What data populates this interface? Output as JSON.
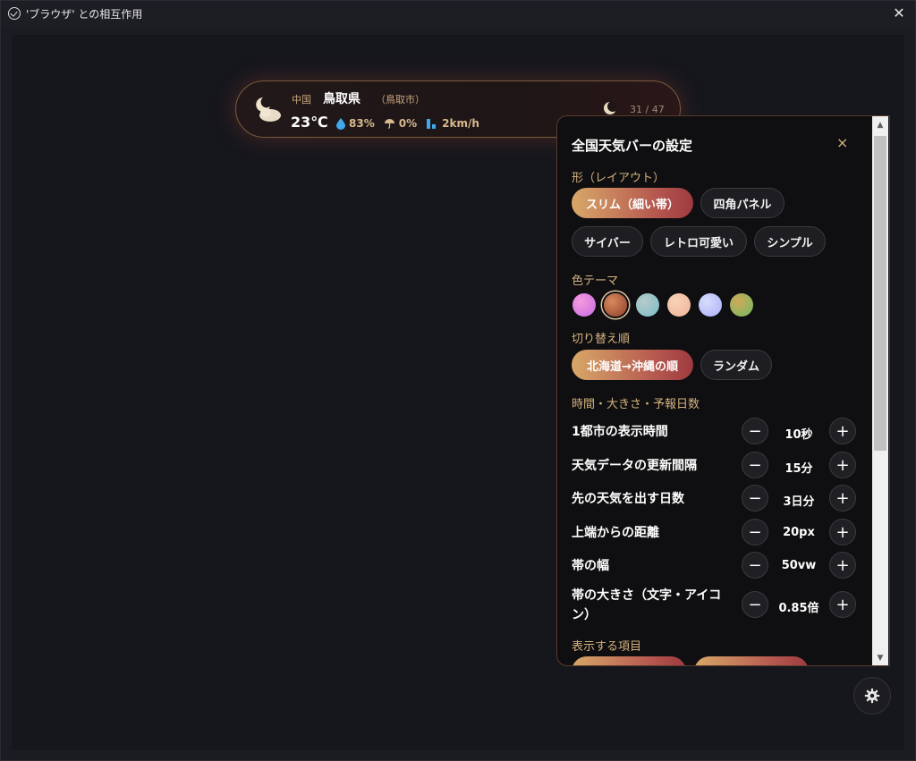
{
  "window": {
    "title": "'ブラウザ' との相互作用"
  },
  "weather_bar": {
    "region": "中国",
    "prefecture": "鳥取県",
    "city": "（鳥取市）",
    "temperature": "23℃",
    "humidity": "83%",
    "precipitation": "0%",
    "wind": "2km/h",
    "counter": "31 / 47"
  },
  "settings": {
    "title": "全国天気バーの設定",
    "layout_label": "形（レイアウト）",
    "layouts": [
      "スリム（細い帯）",
      "四角パネル",
      "サイバー",
      "レトロ可愛い",
      "シンプル"
    ],
    "layout_selected": "スリム（細い帯）",
    "theme_label": "色テーマ",
    "theme_colors": [
      "#e77fe0",
      "#b05a3e",
      "#8fc4c9",
      "#f3c1a4",
      "#b7bdfa",
      "#a6b454"
    ],
    "order_label": "切り替え順",
    "orders": [
      "北海道→沖縄の順",
      "ランダム"
    ],
    "order_selected": "北海道→沖縄の順",
    "timing_label": "時間・大きさ・予報日数",
    "rows": [
      {
        "label": "1都市の表示時間",
        "value": "10秒"
      },
      {
        "label": "天気データの更新間隔",
        "value": "15分"
      },
      {
        "label": "先の天気を出す日数",
        "value": "3日分"
      },
      {
        "label": "上端からの距離",
        "value": "20px"
      },
      {
        "label": "帯の幅",
        "value": "50vw"
      },
      {
        "label": "帯の大きさ（文字・アイコン）",
        "value": "0.85倍"
      }
    ],
    "items_label": "表示する項目",
    "close_label": "×",
    "minus": "−",
    "plus": "+"
  },
  "icons": {
    "window_close": "close-icon",
    "settings": "gear-icon"
  }
}
